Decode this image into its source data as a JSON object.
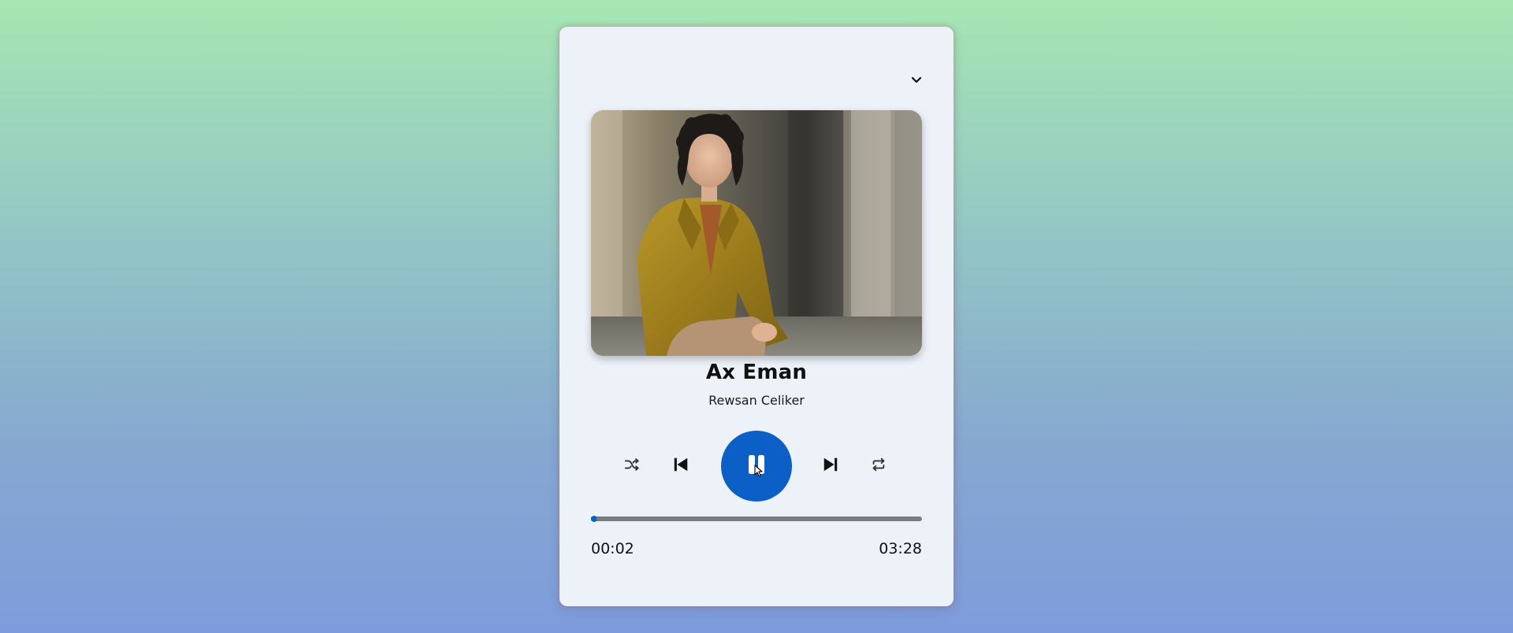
{
  "player": {
    "collapse_icon": "chevron-down-icon",
    "artwork": {
      "description_icon": "album-artwork-photo"
    },
    "song": {
      "title": "Ax Eman",
      "artist": "Rewsan Celiker"
    },
    "controls": {
      "shuffle_icon": "shuffle-icon",
      "previous_icon": "skip-previous-icon",
      "play_pause_icon": "pause-icon",
      "next_icon": "skip-next-icon",
      "repeat_icon": "repeat-icon"
    },
    "progress": {
      "current_time": "00:02",
      "total_time": "03:28",
      "fraction": 0.01
    }
  },
  "colors": {
    "accent": "#0b5fc6",
    "card_background": "#edf2f9",
    "track": "#7a7c82"
  }
}
